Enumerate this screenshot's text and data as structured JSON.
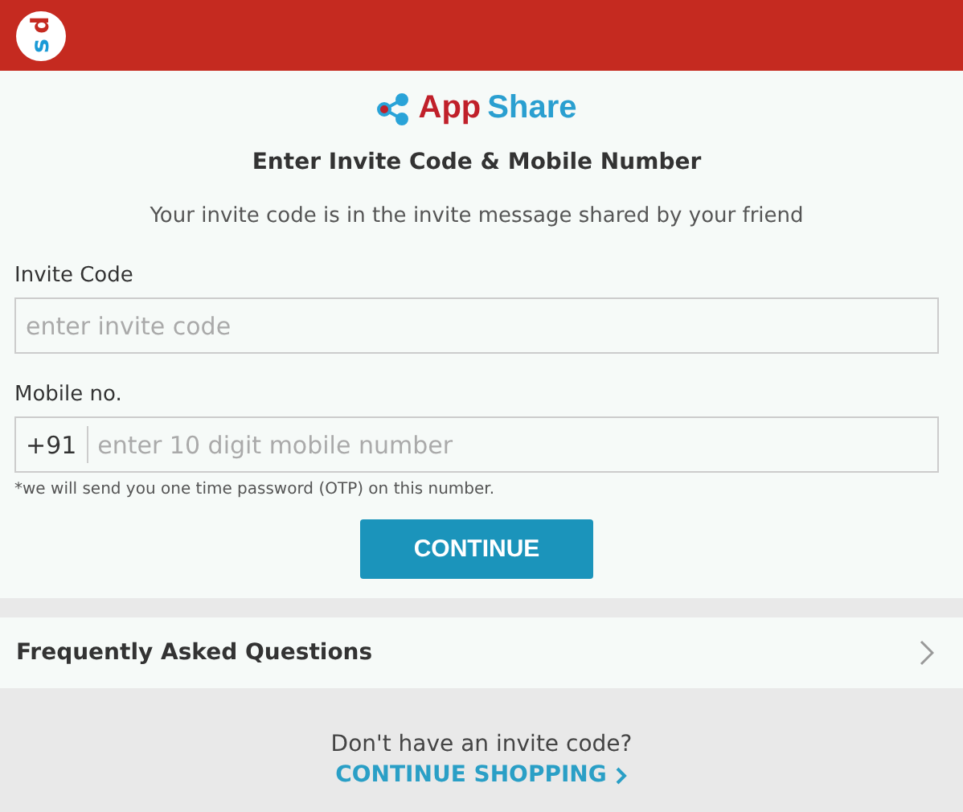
{
  "header": {
    "logo_letters": [
      "s",
      "d"
    ]
  },
  "brand": {
    "parts": [
      "App",
      "Share"
    ]
  },
  "title": "Enter Invite Code & Mobile Number",
  "subtitle": "Your invite code is in the invite message shared by your friend",
  "invite_code": {
    "label": "Invite Code",
    "placeholder": "enter invite code"
  },
  "mobile": {
    "label": "Mobile no.",
    "prefix": "+91",
    "placeholder": "enter 10 digit mobile number",
    "note": "*we will send you one time password (OTP) on this number."
  },
  "continue_button": "CONTINUE",
  "faq": {
    "label": "Frequently Asked Questions"
  },
  "footer": {
    "question": "Don't have an invite code?",
    "link": "CONTINUE SHOPPING"
  }
}
